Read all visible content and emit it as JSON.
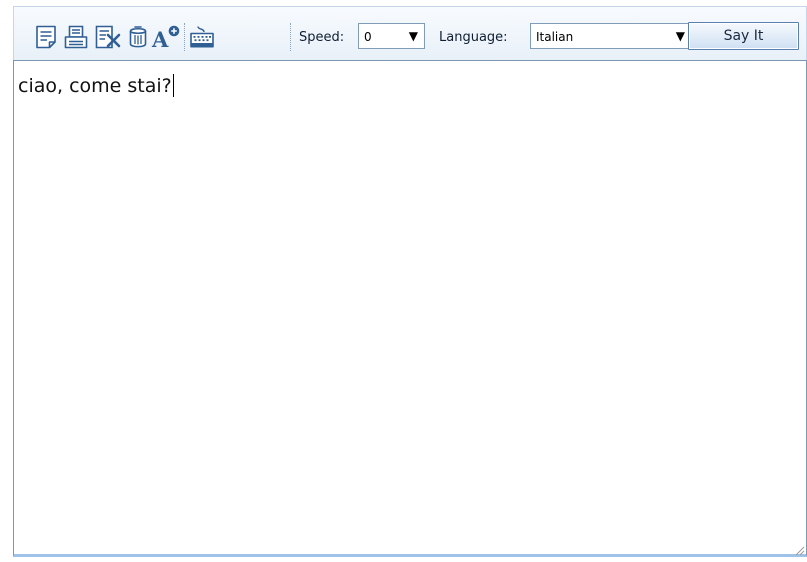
{
  "toolbar": {
    "icons": [
      {
        "name": "new-document-icon",
        "title": "New"
      },
      {
        "name": "print-icon",
        "title": "Print"
      },
      {
        "name": "clear-icon",
        "title": "Clear"
      },
      {
        "name": "trash-icon",
        "title": "Delete"
      },
      {
        "name": "font-size-icon",
        "title": "Font size"
      },
      {
        "name": "keyboard-icon",
        "title": "Keyboard"
      }
    ],
    "speed_label": "Speed:",
    "speed_value": "0",
    "language_label": "Language:",
    "language_value": "Italian",
    "say_button_label": "Say It"
  },
  "editor": {
    "text": "ciao, come stai?"
  },
  "colors": {
    "toolbar_bg": "#e8f0f8",
    "border": "#7d96b4",
    "icon": "#2f5f94",
    "button_border": "#5a7fb0"
  }
}
